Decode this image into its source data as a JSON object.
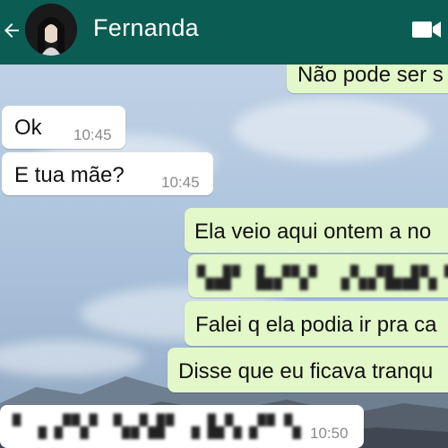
{
  "contact": {
    "name": "Fernanda"
  },
  "messages": [
    {
      "dir": "out",
      "text": "Não pode ser s"
    },
    {
      "dir": "in",
      "text": "Ok",
      "time": "10:45"
    },
    {
      "dir": "in",
      "text": "E tua mãe?",
      "time": "10:45"
    },
    {
      "dir": "out",
      "text": "Ela veio aqui ontem a no"
    },
    {
      "dir": "out",
      "text": "▚▟▘ ▙▞▚▘ ▗▚▞▙▟▚ ▘▙▞▚▗▚▟",
      "blurred": true
    },
    {
      "dir": "out",
      "text": "Falei q ela podia ir pra ca"
    },
    {
      "dir": "out",
      "text": "Disse que eu ficava tranqu"
    },
    {
      "dir": "in",
      "text": "▘▗ ▞▚▘ ▚▞▟▘▗ ▙▚ ▞▘▚",
      "time": "10:50",
      "blurred": true
    }
  ],
  "icons": {
    "back": "arrow-left-icon",
    "video": "video-camera-icon"
  },
  "colors": {
    "header": "#0b5d53",
    "incoming": "#ffffff",
    "outgoing": "#e2f8c9"
  }
}
